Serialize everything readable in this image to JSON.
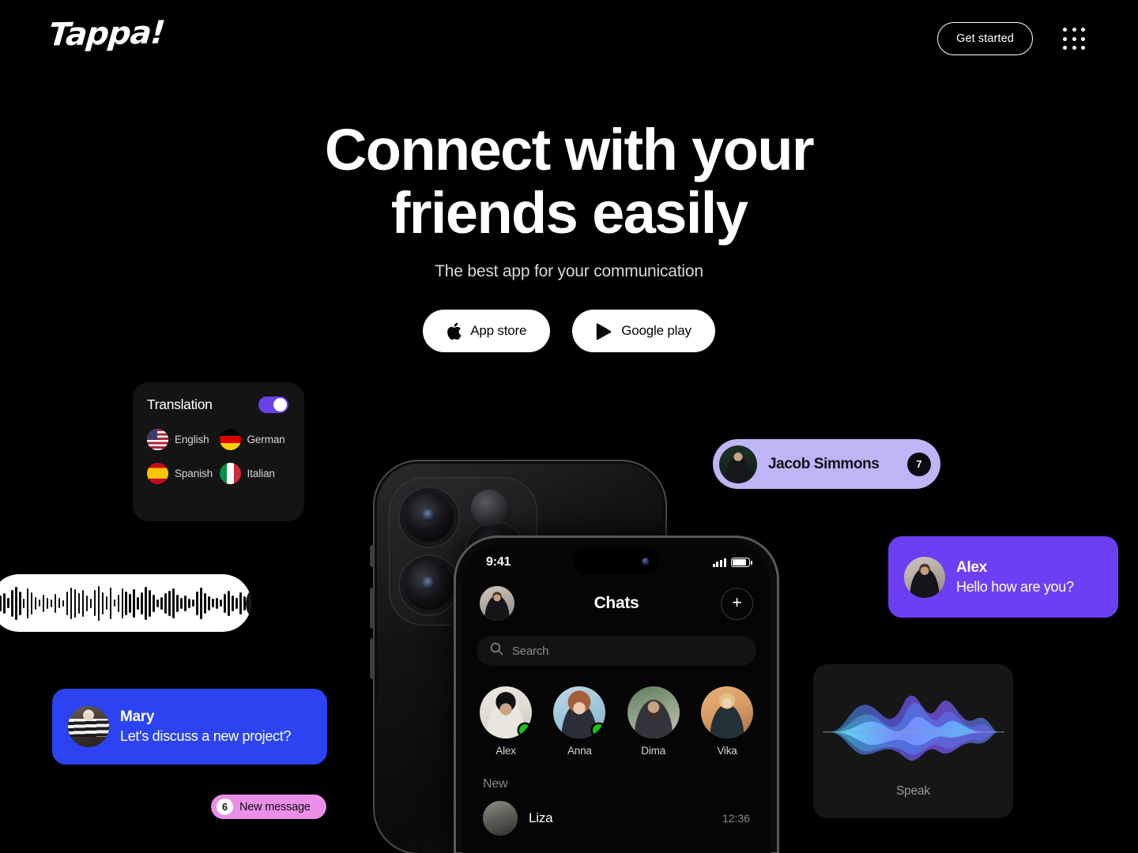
{
  "header": {
    "logo": "Tappa!",
    "get_started_label": "Get started",
    "menu_icon": "grid-menu-icon"
  },
  "hero": {
    "heading_line1": "Connect with your",
    "heading_line2": "friends easily",
    "subtitle": "The best app for your communication",
    "buttons": [
      {
        "label": "App store",
        "icon": "apple-icon"
      },
      {
        "label": "Google play",
        "icon": "google-play-icon"
      }
    ]
  },
  "translation_card": {
    "title": "Translation",
    "toggle_on": true,
    "toggle_color": "#6942ea",
    "languages": [
      {
        "label": "English",
        "flag": "flag-us-icon"
      },
      {
        "label": "German",
        "flag": "flag-de-icon"
      },
      {
        "label": "Spanish",
        "flag": "flag-es-icon"
      },
      {
        "label": "Italian",
        "flag": "flag-it-icon"
      }
    ]
  },
  "voice_bar": {
    "mic_icon": "microphone-icon",
    "waveform_heights": [
      14,
      20,
      26,
      13,
      34,
      42,
      30,
      12,
      38,
      28,
      16,
      9,
      22,
      14,
      10,
      24,
      13,
      8,
      30,
      40,
      36,
      26,
      34,
      20,
      12,
      33,
      44,
      28,
      17,
      40,
      9,
      22,
      38,
      30,
      24,
      36,
      16,
      28,
      42,
      34,
      22,
      10,
      16,
      26,
      32,
      38,
      22,
      14,
      20,
      12,
      9,
      30,
      40,
      26,
      18,
      11,
      14,
      9,
      24,
      32,
      20,
      14,
      28,
      18
    ]
  },
  "messages": {
    "mary": {
      "name": "Mary",
      "text": "Let's discuss a new project?",
      "color": "#2b43f0",
      "avatar": "mary-avatar"
    },
    "alex": {
      "name": "Alex",
      "text": "Hello how are you?",
      "color": "#6d3ff2",
      "avatar": "alex-avatar"
    }
  },
  "new_message_pill": {
    "count": "6",
    "label": "New message",
    "color": "#e98fe8"
  },
  "jacob_chip": {
    "name": "Jacob Simmons",
    "badge": "7",
    "color": "#bfb4f6",
    "avatar": "jacob-avatar"
  },
  "speak_card": {
    "label": "Speak"
  },
  "phone": {
    "status": {
      "time": "9:41",
      "signal_icon": "cellular-signal-icon",
      "battery_icon": "battery-icon"
    },
    "nav": {
      "title": "Chats",
      "add_label": "+",
      "avatar": "user-avatar"
    },
    "search": {
      "placeholder": "Search",
      "icon": "search-icon"
    },
    "contacts": [
      {
        "name": "Alex",
        "online": true,
        "avatar": "alex-contact-avatar"
      },
      {
        "name": "Anna",
        "online": true,
        "avatar": "anna-contact-avatar"
      },
      {
        "name": "Dima",
        "online": false,
        "avatar": "dima-contact-avatar"
      },
      {
        "name": "Vika",
        "online": false,
        "avatar": "vika-contact-avatar"
      }
    ],
    "section_new": "New",
    "chats": [
      {
        "name": "Liza",
        "time": "12:36",
        "avatar": "liza-avatar"
      }
    ]
  }
}
